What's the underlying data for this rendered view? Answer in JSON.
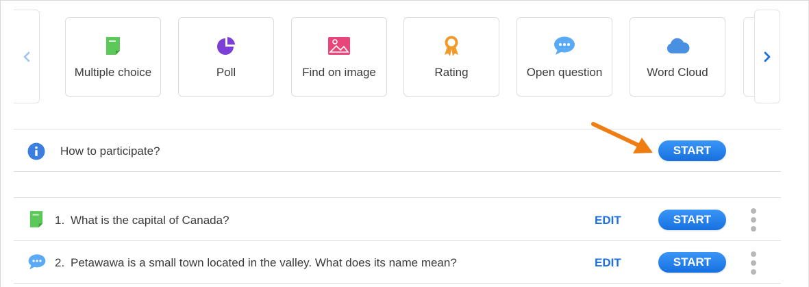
{
  "carousel": {
    "cards": [
      {
        "label": "Multiple choice",
        "icon": "multiple-choice-icon"
      },
      {
        "label": "Poll",
        "icon": "poll-pie-icon"
      },
      {
        "label": "Find on image",
        "icon": "image-icon"
      },
      {
        "label": "Rating",
        "icon": "rating-ribbon-icon"
      },
      {
        "label": "Open question",
        "icon": "speech-bubble-icon"
      },
      {
        "label": "Word Cloud",
        "icon": "cloud-icon"
      }
    ]
  },
  "intro": {
    "text": "How to participate?",
    "start_label": "START",
    "icon": "info-icon"
  },
  "questions": [
    {
      "number": "1.",
      "text": "What is the capital of Canada?",
      "edit_label": "EDIT",
      "start_label": "START",
      "icon": "multiple-choice-icon"
    },
    {
      "number": "2.",
      "text": "Petawawa is a small town located in the valley. What does its name mean?",
      "edit_label": "EDIT",
      "start_label": "START",
      "icon": "speech-bubble-icon"
    }
  ],
  "colors": {
    "accent": "#1e6fe0",
    "start_button": "#2380ea",
    "arrow": "#f07d12",
    "green": "#5cc85a",
    "purple": "#7b3ed6",
    "pink": "#e8457a",
    "orange": "#f09a2a",
    "light_blue": "#5aaaf5",
    "cloud_blue": "#4a90e2"
  }
}
